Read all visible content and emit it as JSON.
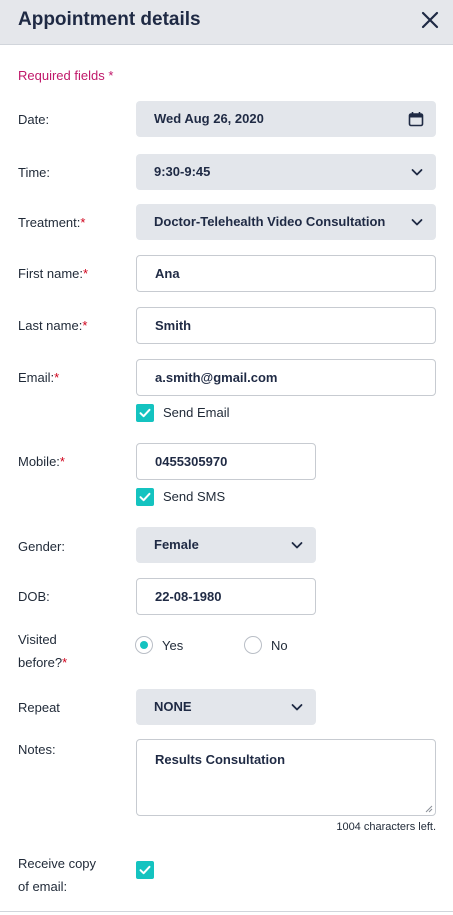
{
  "header": {
    "title": "Appointment details",
    "close_icon": "close-icon"
  },
  "required_note": {
    "text": "Required fields ",
    "star": "*"
  },
  "required_star": "*",
  "fields": {
    "date": {
      "label": "Date:",
      "value": "Wed Aug 26, 2020",
      "icon": "calendar-icon"
    },
    "time": {
      "label": "Time:",
      "value": "9:30-9:45",
      "icon": "chevron-down-icon"
    },
    "treatment": {
      "label": "Treatment:",
      "value": "Doctor-Telehealth Video Consultation",
      "icon": "chevron-down-icon"
    },
    "first_name": {
      "label": "First name:",
      "value": "Ana"
    },
    "last_name": {
      "label": "Last name:",
      "value": "Smith"
    },
    "email": {
      "label": "Email:",
      "value": "a.smith@gmail.com",
      "send_label": "Send Email",
      "send_checked": true
    },
    "mobile": {
      "label": "Mobile:",
      "value": "0455305970",
      "send_label": "Send SMS",
      "send_checked": true
    },
    "gender": {
      "label": "Gender:",
      "value": "Female",
      "icon": "chevron-down-icon"
    },
    "dob": {
      "label": "DOB:",
      "value": "22-08-1980"
    },
    "visited": {
      "label_line1": "Visited",
      "label_line2": "before?",
      "options": [
        "Yes",
        "No"
      ],
      "selected": "Yes"
    },
    "repeat": {
      "label": "Repeat",
      "value": "NONE",
      "icon": "chevron-down-icon"
    },
    "notes": {
      "label": "Notes:",
      "value": "Results Consultation",
      "chars_left": "1004 characters left."
    },
    "receive_copy": {
      "label_line1": "Receive copy",
      "label_line2": "of email:",
      "checked": true
    }
  },
  "colors": {
    "accent": "#14c3c0",
    "required": "#c0186a",
    "header_bg": "#e5e7eb",
    "select_bg": "#e3e6eb"
  }
}
